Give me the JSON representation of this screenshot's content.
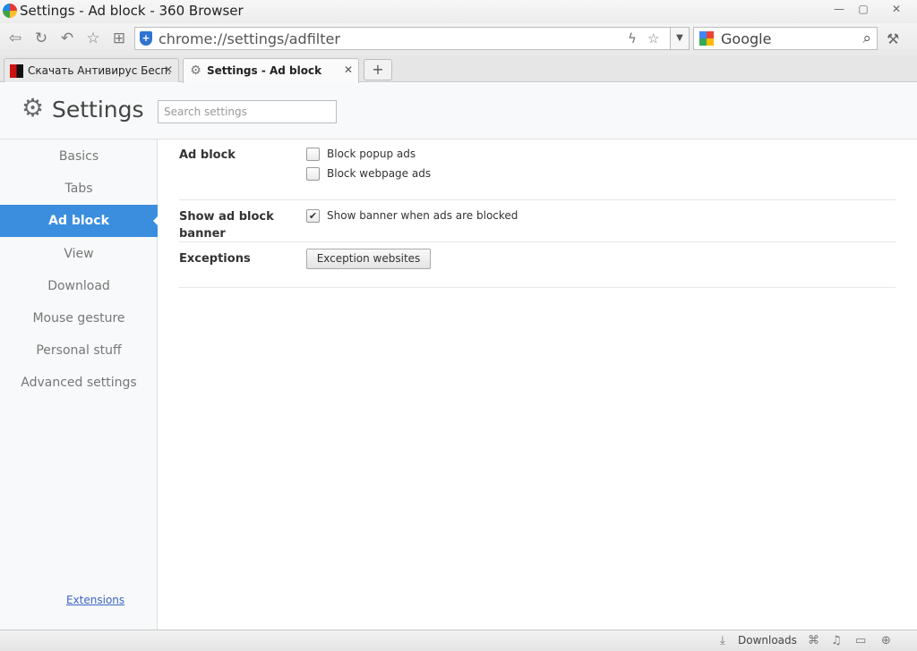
{
  "window": {
    "title": "Settings - Ad block - 360 Browser",
    "minimize_icon": "—",
    "restore_icon": "▢",
    "close_icon": "✕"
  },
  "toolbar": {
    "back_icon": "⇦",
    "refresh_icon": "↻",
    "undo_icon": "↶",
    "favorites_icon": "☆",
    "apps_icon": "⊞",
    "address_url": "chrome://settings/adfilter",
    "shield_glyph": "+",
    "lightning_icon": "ϟ",
    "star_icon": "☆",
    "dropdown_icon": "▼",
    "search_engine": "Google",
    "search_icon": "⌕",
    "tools_icon": "⚒"
  },
  "tabs": [
    {
      "title": "Скачать Антивирус Бесп.",
      "active": false,
      "close": "✕"
    },
    {
      "title": "Settings - Ad block",
      "active": true,
      "close": "✕"
    }
  ],
  "newtab_label": "+",
  "header": {
    "gear_icon": "⚙",
    "title": "Settings",
    "search_placeholder": "Search settings"
  },
  "sidebar": {
    "items": [
      {
        "label": "Basics",
        "active": false
      },
      {
        "label": "Tabs",
        "active": false
      },
      {
        "label": "Ad block",
        "active": true
      },
      {
        "label": "View",
        "active": false
      },
      {
        "label": "Download",
        "active": false
      },
      {
        "label": "Mouse gesture",
        "active": false
      },
      {
        "label": "Personal stuff",
        "active": false
      },
      {
        "label": "Advanced settings",
        "active": false
      }
    ],
    "extensions_link": "Extensions"
  },
  "sections": {
    "ad_block": {
      "label": "Ad block",
      "options": [
        {
          "label": "Block popup ads",
          "checked": false
        },
        {
          "label": "Block webpage ads",
          "checked": false
        }
      ]
    },
    "banner": {
      "label_line1": "Show ad block",
      "label_line2": "banner",
      "option": {
        "label": "Show banner when ads are blocked",
        "checked": true
      }
    },
    "exceptions": {
      "label": "Exceptions",
      "button": "Exception websites"
    }
  },
  "check_mark": "✔",
  "statusbar": {
    "downloads_label": "Downloads",
    "download_icon": "⤓",
    "trash_icon": "⌘",
    "sound_icon": "♫",
    "screen_icon": "▭",
    "zoom_icon": "⊕"
  },
  "colors": {
    "accent": "#3b8ede",
    "link": "#3a64c8"
  }
}
